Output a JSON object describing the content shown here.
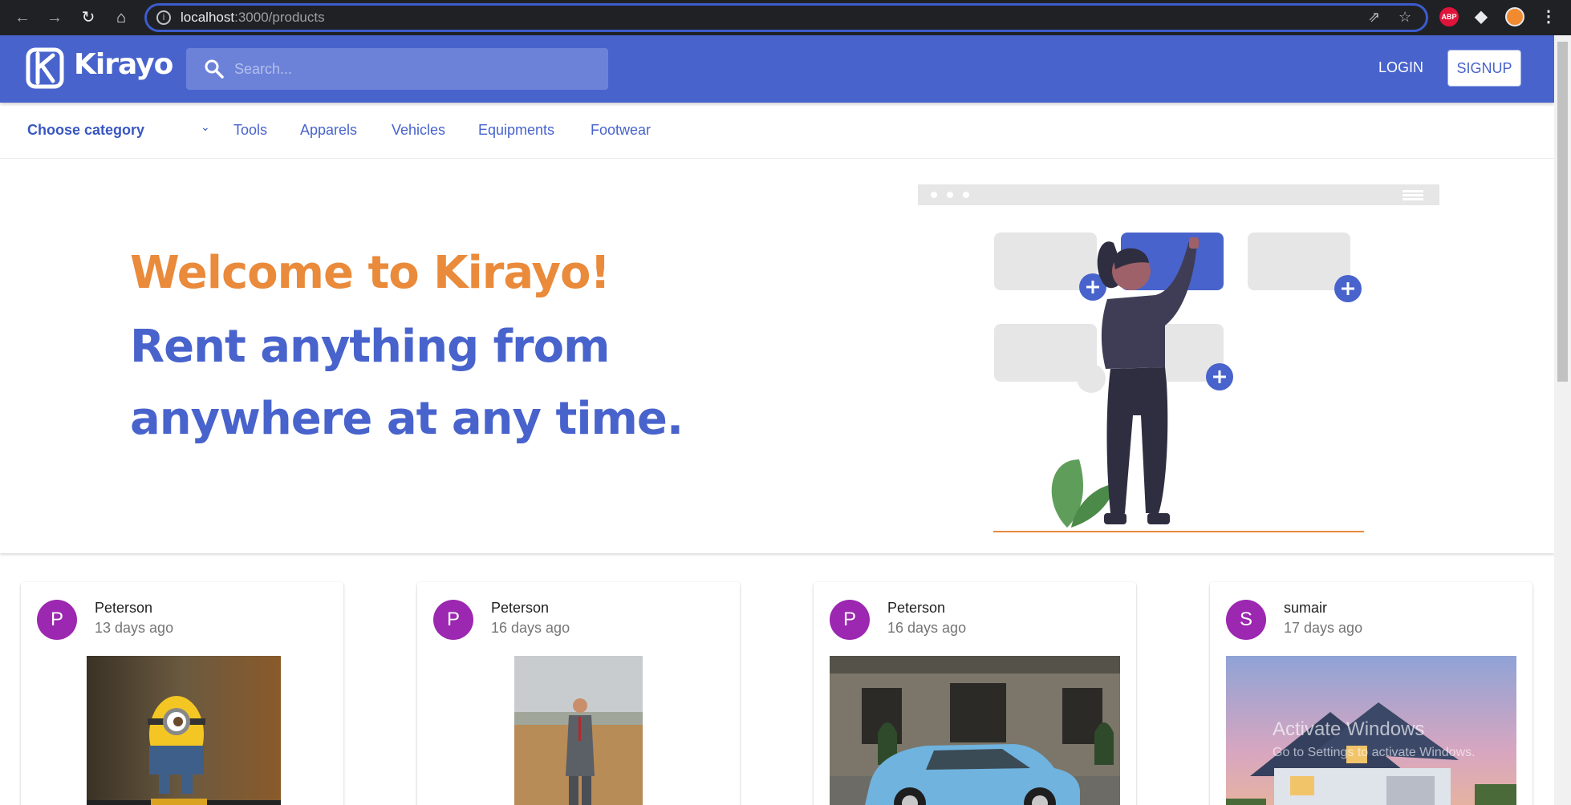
{
  "browser": {
    "url_host": "localhost",
    "url_path": ":3000/products",
    "ext_abp": "ABP"
  },
  "header": {
    "logo_text": "Kirayo",
    "search_placeholder": "Search...",
    "login_label": "LOGIN",
    "signup_label": "SIGNUP",
    "brand_color": "#4863cc",
    "accent_color": "#ea8a3b"
  },
  "categories": {
    "select_label": "Choose category",
    "items": [
      "Tools",
      "Apparels",
      "Vehicles",
      "Equipments",
      "Footwear"
    ]
  },
  "hero": {
    "welcome": "Welcome to Kirayo!",
    "line1": "Rent anything from",
    "line2": "anywhere at any time."
  },
  "products": [
    {
      "initial": "P",
      "owner": "Peterson",
      "posted": "13 days ago",
      "image": "minion-figure"
    },
    {
      "initial": "P",
      "owner": "Peterson",
      "posted": "16 days ago",
      "image": "man-in-suit"
    },
    {
      "initial": "P",
      "owner": "Peterson",
      "posted": "16 days ago",
      "image": "blue-car"
    },
    {
      "initial": "S",
      "owner": "sumair",
      "posted": "17 days ago",
      "image": "house"
    }
  ],
  "watermark": {
    "title": "Activate Windows",
    "subtitle": "Go to Settings to activate Windows."
  }
}
